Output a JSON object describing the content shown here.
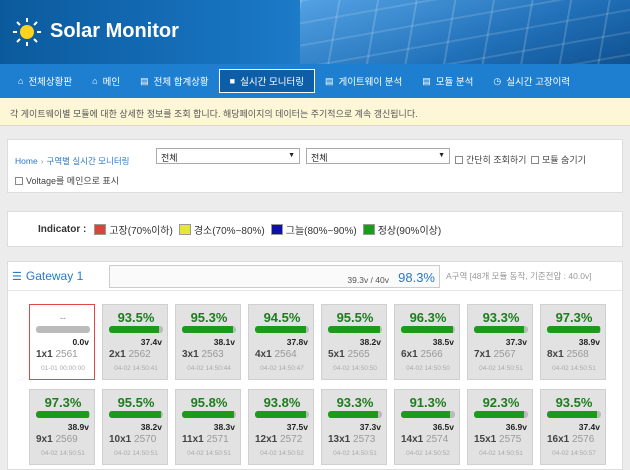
{
  "header": {
    "title": "Solar Monitor",
    "logo_icon": "sun-icon"
  },
  "nav": [
    {
      "label": "전체상황판",
      "icon": "home-icon",
      "active": false
    },
    {
      "label": "메인",
      "icon": "home-icon",
      "active": false
    },
    {
      "label": "전체 합계상황",
      "icon": "document-icon",
      "active": false
    },
    {
      "label": "실시간 모니터링",
      "icon": "video-icon",
      "active": true
    },
    {
      "label": "게이트웨이 분석",
      "icon": "document-icon",
      "active": false
    },
    {
      "label": "모듈 분석",
      "icon": "document-icon",
      "active": false
    },
    {
      "label": "실시간 고장이력",
      "icon": "clock-icon",
      "active": false
    }
  ],
  "info_text": "각 게이트웨이별 모듈에 대한 상세한 정보를 조회 합니다. 해당페이지의 데이터는 주기적으로 계속 갱신됩니다.",
  "breadcrumb": {
    "home": "Home",
    "current": "구역별 실시간 모니터링"
  },
  "filters": {
    "select1_value": "전체",
    "select2_value": "전체",
    "checkbox_simple": "간단히 조회하기",
    "checkbox_hide": "모듈 숨기기",
    "checkbox_voltage": "Voltage를 메인으로 표시"
  },
  "indicator": {
    "title": "Indicator :",
    "items": [
      {
        "label": "고장(70%이하)",
        "color": "#d9443b"
      },
      {
        "label": "경소(70%~80%)",
        "color": "#e6e63a"
      },
      {
        "label": "그늘(80%~90%)",
        "color": "#1010a8"
      },
      {
        "label": "정상(90%이상)",
        "color": "#1c9a1c"
      }
    ]
  },
  "gateway": {
    "title": "Gateway 1",
    "voltage": "39.3v / 40v",
    "percent": "98.3%",
    "info": "A구역 [48개 모듈 동작, 기준전압 : 40.0v]"
  },
  "modules": [
    {
      "pct": "--",
      "fill": 0,
      "volt": "0.0v",
      "id": "1x1",
      "num": "2561",
      "ts": "01-01 00:00:00",
      "fault": true
    },
    {
      "pct": "93.5%",
      "fill": 93.5,
      "volt": "37.4v",
      "id": "2x1",
      "num": "2562",
      "ts": "04-02 14:50:41",
      "fault": false
    },
    {
      "pct": "95.3%",
      "fill": 95.3,
      "volt": "38.1v",
      "id": "3x1",
      "num": "2563",
      "ts": "04-02 14:50:44",
      "fault": false
    },
    {
      "pct": "94.5%",
      "fill": 94.5,
      "volt": "37.8v",
      "id": "4x1",
      "num": "2564",
      "ts": "04-02 14:50:47",
      "fault": false
    },
    {
      "pct": "95.5%",
      "fill": 95.5,
      "volt": "38.2v",
      "id": "5x1",
      "num": "2565",
      "ts": "04-02 14:50:50",
      "fault": false
    },
    {
      "pct": "96.3%",
      "fill": 96.3,
      "volt": "38.5v",
      "id": "6x1",
      "num": "2566",
      "ts": "04-02 14:50:50",
      "fault": false
    },
    {
      "pct": "93.3%",
      "fill": 93.3,
      "volt": "37.3v",
      "id": "7x1",
      "num": "2567",
      "ts": "04-02 14:50:51",
      "fault": false
    },
    {
      "pct": "97.3%",
      "fill": 97.3,
      "volt": "38.9v",
      "id": "8x1",
      "num": "2568",
      "ts": "04-02 14:50:51",
      "fault": false
    },
    {
      "pct": "97.3%",
      "fill": 97.3,
      "volt": "38.9v",
      "id": "9x1",
      "num": "2569",
      "ts": "04-02 14:50:51",
      "fault": false
    },
    {
      "pct": "95.5%",
      "fill": 95.5,
      "volt": "38.2v",
      "id": "10x1",
      "num": "2570",
      "ts": "04-02 14:50:51",
      "fault": false
    },
    {
      "pct": "95.8%",
      "fill": 95.8,
      "volt": "38.3v",
      "id": "11x1",
      "num": "2571",
      "ts": "04-02 14:50:51",
      "fault": false
    },
    {
      "pct": "93.8%",
      "fill": 93.8,
      "volt": "37.5v",
      "id": "12x1",
      "num": "2572",
      "ts": "04-02 14:50:52",
      "fault": false
    },
    {
      "pct": "93.3%",
      "fill": 93.3,
      "volt": "37.3v",
      "id": "13x1",
      "num": "2573",
      "ts": "04-02 14:50:51",
      "fault": false
    },
    {
      "pct": "91.3%",
      "fill": 91.3,
      "volt": "36.5v",
      "id": "14x1",
      "num": "2574",
      "ts": "04-02 14:50:52",
      "fault": false
    },
    {
      "pct": "92.3%",
      "fill": 92.3,
      "volt": "36.9v",
      "id": "15x1",
      "num": "2575",
      "ts": "04-02 14:50:51",
      "fault": false
    },
    {
      "pct": "93.5%",
      "fill": 93.5,
      "volt": "37.4v",
      "id": "16x1",
      "num": "2576",
      "ts": "04-02 14:50:57",
      "fault": false
    }
  ]
}
